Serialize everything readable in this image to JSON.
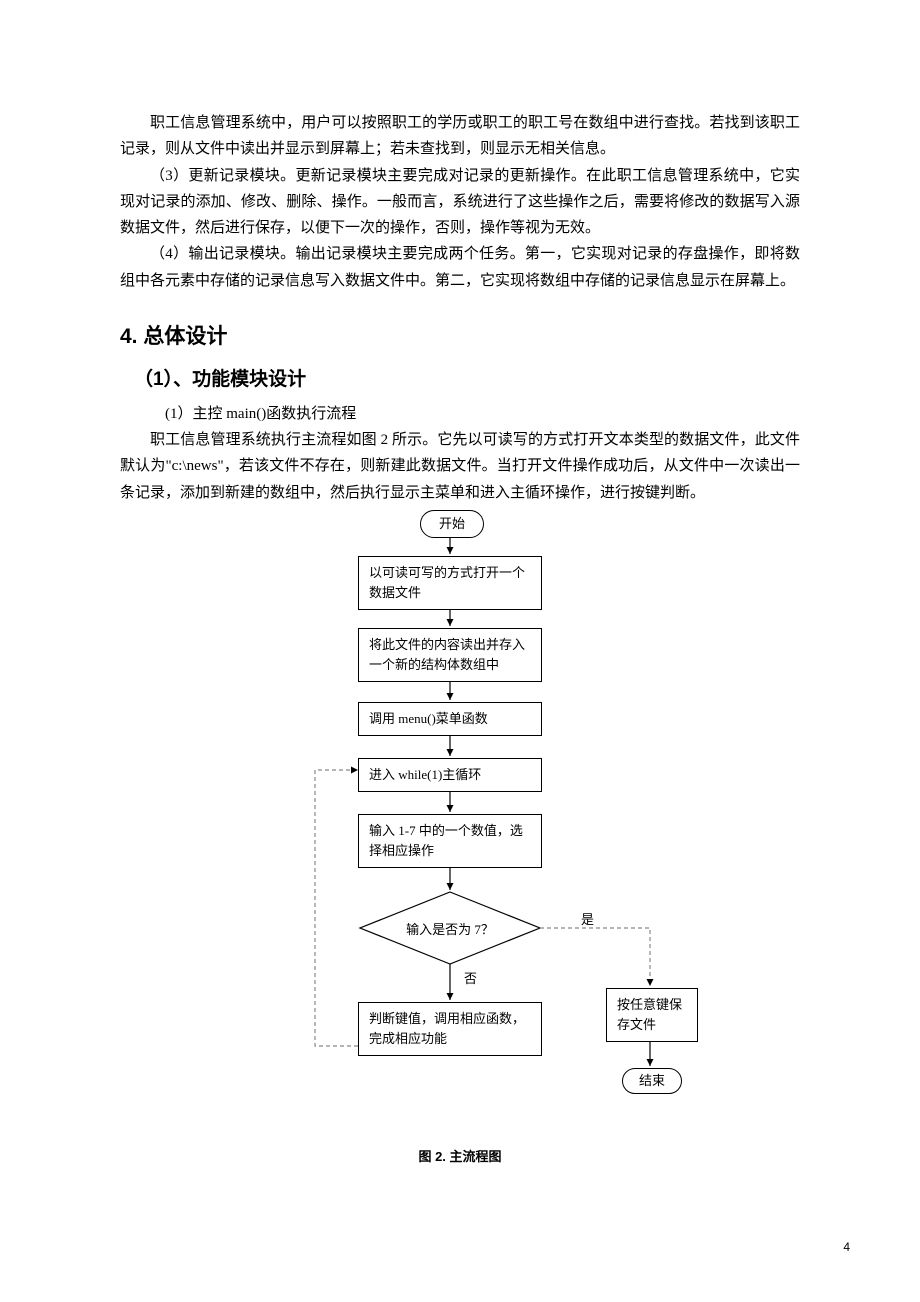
{
  "para1": "职工信息管理系统中，用户可以按照职工的学历或职工的职工号在数组中进行查找。若找到该职工记录，则从文件中读出并显示到屏幕上；若未查找到，则显示无相关信息。",
  "para2": "（3）更新记录模块。更新记录模块主要完成对记录的更新操作。在此职工信息管理系统中，它实现对记录的添加、修改、删除、操作。一般而言，系统进行了这些操作之后，需要将修改的数据写入源数据文件，然后进行保存，以便下一次的操作，否则，操作等视为无效。",
  "para3": "（4）输出记录模块。输出记录模块主要完成两个任务。第一，它实现对记录的存盘操作，即将数组中各元素中存储的记录信息写入数据文件中。第二，它实现将数组中存储的记录信息显示在屏幕上。",
  "h1": "4. 总体设计",
  "h2": "（1）、功能模块设计",
  "sub1": "(1）主控 main()函数执行流程",
  "para4": "职工信息管理系统执行主流程如图 2 所示。它先以可读写的方式打开文本类型的数据文件，此文件默认为\"c:\\news\"，若该文件不存在，则新建此数据文件。当打开文件操作成功后，从文件中一次读出一条记录，添加到新建的数组中，然后执行显示主菜单和进入主循环操作，进行按键判断。",
  "flow": {
    "start": "开始",
    "b1": "以可读可写的方式打开一个数据文件",
    "b2": "将此文件的内容读出并存入一个新的结构体数组中",
    "b3": "调用 menu()菜单函数",
    "b4": "进入 while(1)主循环",
    "b5": "输入 1-7 中的一个数值，选择相应操作",
    "d1": "输入是否为 7？",
    "b6": "判断键值，调用相应函数，完成相应功能",
    "b7": "按任意键保存文件",
    "end": "结束",
    "yes": "是",
    "no": "否"
  },
  "caption": "图 2. 主流程图",
  "page_number": "4"
}
